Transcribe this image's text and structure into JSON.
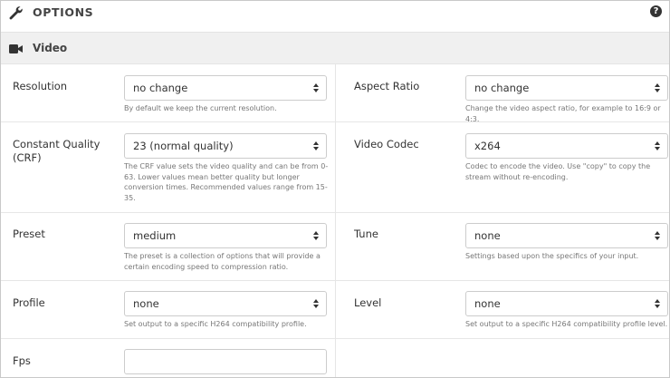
{
  "header": {
    "title": "OPTIONS",
    "help_glyph": "?"
  },
  "section": {
    "title": "Video"
  },
  "fields": {
    "resolution": {
      "label": "Resolution",
      "value": "no change",
      "help": "By default we keep the current resolution."
    },
    "aspect_ratio": {
      "label": "Aspect Ratio",
      "value": "no change",
      "help": "Change the video aspect ratio, for example to 16:9 or 4:3."
    },
    "crf": {
      "label_line1": "Constant Quality",
      "label_line2": "(CRF)",
      "value": "23 (normal quality)",
      "help_line1": "The CRF value sets the video quality and can be from 0-",
      "help_line2": "63. Lower values mean better quality but longer",
      "help_line3": "conversion times. Recommended values range from 15-",
      "help_line4": "35."
    },
    "video_codec": {
      "label": "Video Codec",
      "value": "x264",
      "help_line1": "Codec to encode the video. Use \"copy\" to copy the",
      "help_line2": "stream without re-encoding."
    },
    "preset": {
      "label": "Preset",
      "value": "medium",
      "help_line1": "The preset is a collection of options that will provide a",
      "help_line2": "certain encoding speed to compression ratio."
    },
    "tune": {
      "label": "Tune",
      "value": "none",
      "help": "Settings based upon the specifics of your input."
    },
    "profile": {
      "label": "Profile",
      "value": "none",
      "help": "Set output to a specific H264 compatibility profile."
    },
    "level": {
      "label": "Level",
      "value": "none",
      "help": "Set output to a specific H264 compatibility profile level."
    },
    "fps": {
      "label": "Fps",
      "value": ""
    }
  },
  "icons": {
    "header": "wrench-icon",
    "section": "video-camera-icon",
    "help": "question-circle-icon",
    "select": "sort-arrows-icon"
  }
}
